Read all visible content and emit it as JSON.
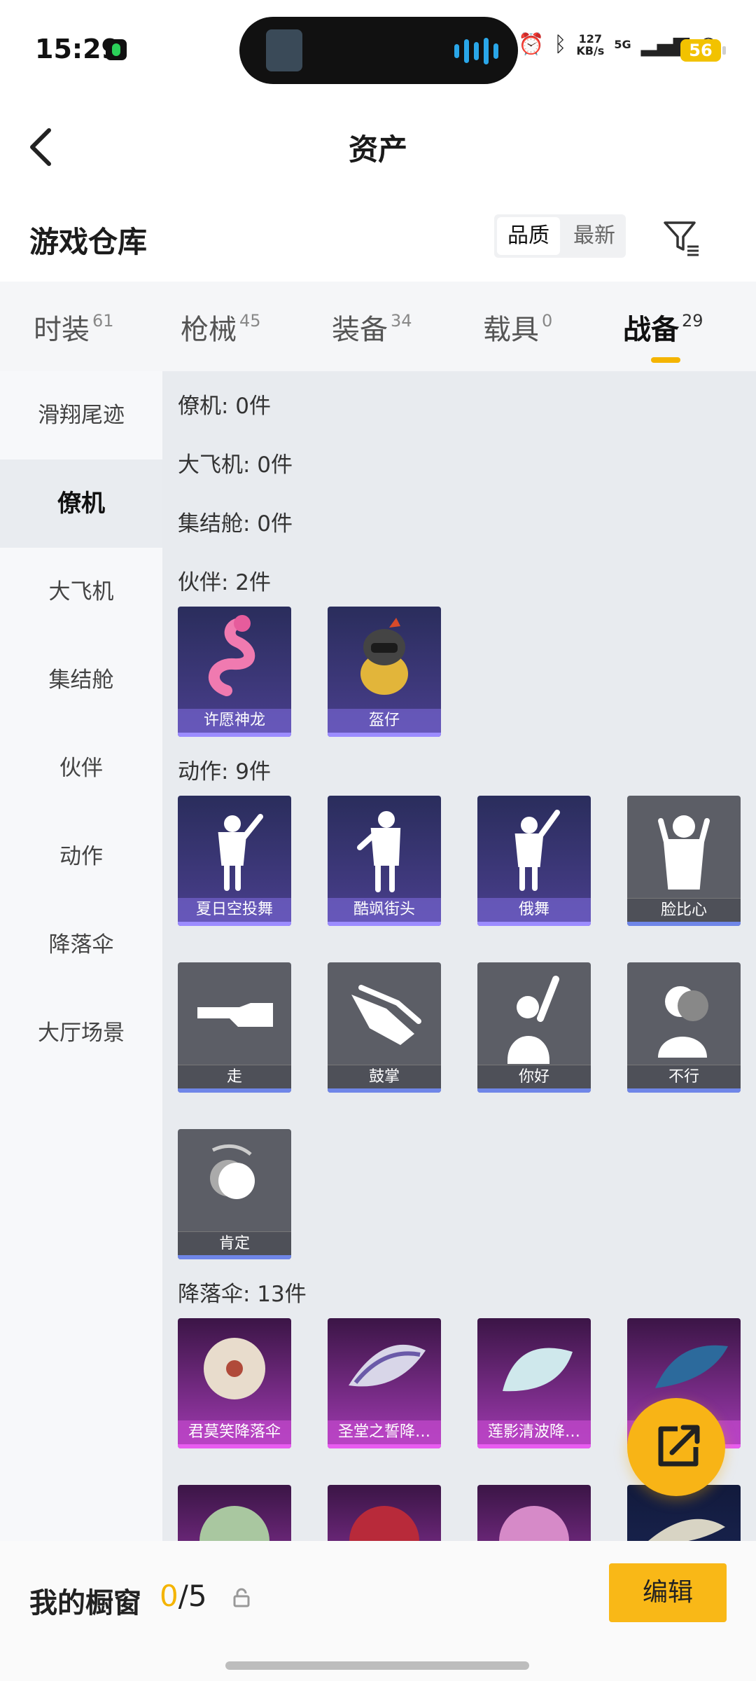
{
  "status_bar": {
    "time": "15:29",
    "net_speed": "127",
    "net_unit": "KB/s",
    "network": "5G",
    "battery": "56"
  },
  "header": {
    "title": "资产",
    "back_icon": "chevron-left-icon"
  },
  "warehouse": {
    "title": "游戏仓库",
    "sort_options": [
      "品质",
      "最新"
    ],
    "sort_selected": "品质"
  },
  "category_tabs": [
    {
      "label": "时装",
      "count": "61"
    },
    {
      "label": "枪械",
      "count": "45"
    },
    {
      "label": "装备",
      "count": "34"
    },
    {
      "label": "载具",
      "count": "0"
    },
    {
      "label": "战备",
      "count": "29",
      "active": true
    }
  ],
  "sidebar": [
    "滑翔尾迹",
    "僚机",
    "大飞机",
    "集结舱",
    "伙伴",
    "动作",
    "降落伞",
    "大厅场景"
  ],
  "sidebar_active": "僚机",
  "sections": {
    "wingman": "僚机: 0件",
    "plane": "大飞机: 0件",
    "capsule": "集结舱: 0件",
    "partner": "伙伴: 2件",
    "emote": "动作: 9件",
    "parachute": "降落伞: 13件"
  },
  "partners": [
    "许愿神龙",
    "盔仔"
  ],
  "emotes": [
    "夏日空投舞",
    "酷飒街头",
    "俄舞",
    "脸比心",
    "走",
    "鼓掌",
    "你好",
    "不行",
    "肯定"
  ],
  "parachutes": [
    "君莫笑降落伞",
    "圣堂之誓降…",
    "莲影清波降…",
    ""
  ],
  "bottom": {
    "label": "我的橱窗",
    "count_current": "0",
    "count_total": "/5",
    "edit_label": "编辑"
  },
  "colors": {
    "accent": "#F4B400",
    "edit_button": "#F9B817"
  }
}
